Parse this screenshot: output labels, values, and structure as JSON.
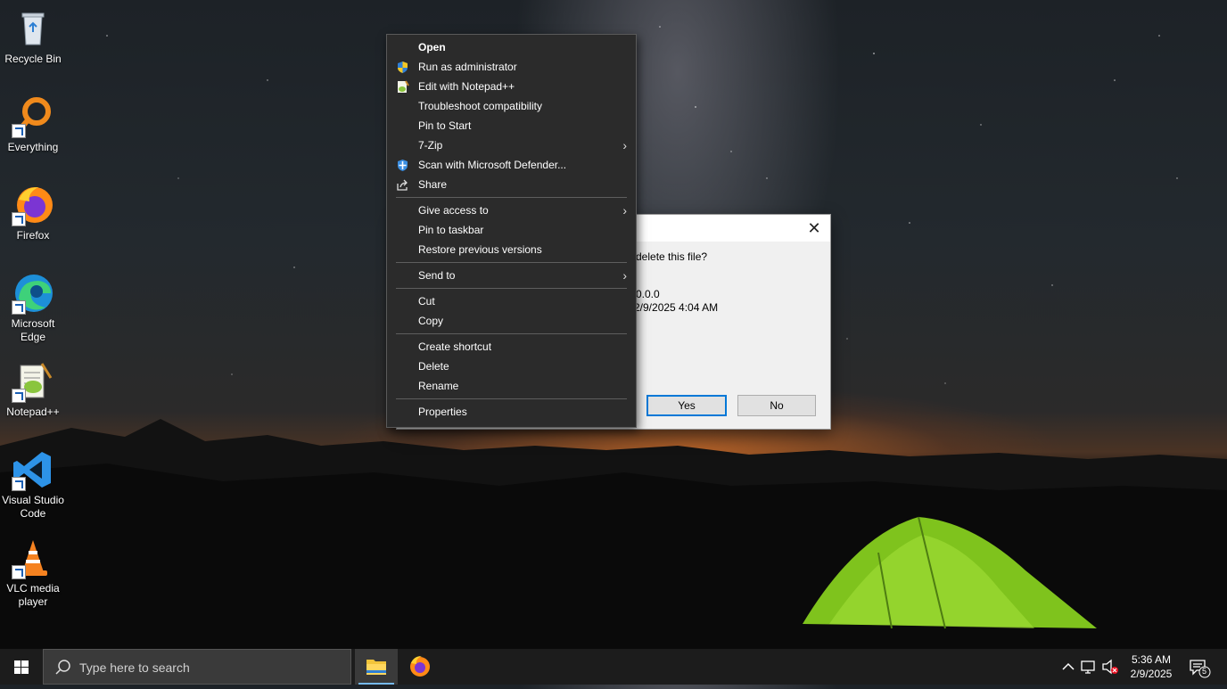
{
  "desktop": {
    "icons": [
      {
        "label": "Recycle Bin"
      },
      {
        "label": "Everything"
      },
      {
        "label": "Firefox"
      },
      {
        "label": "Microsoft Edge"
      },
      {
        "label": "Notepad++"
      },
      {
        "label": "Visual Studio Code"
      },
      {
        "label": "VLC media player"
      }
    ]
  },
  "dialog": {
    "close_glyph": "✕",
    "message": "delete this file?",
    "info_line1": "0.0.0",
    "info_line2": "2/9/2025 4:04 AM",
    "yes_label": "Yes",
    "no_label": "No"
  },
  "context_menu": {
    "items": [
      {
        "label": "Open"
      },
      {
        "label": "Run as administrator",
        "icon": "shield-icon"
      },
      {
        "label": "Edit with Notepad++",
        "icon": "notepadpp-icon"
      },
      {
        "label": "Troubleshoot compatibility"
      },
      {
        "label": "Pin to Start"
      },
      {
        "label": "7-Zip",
        "submenu": true
      },
      {
        "label": "Scan with Microsoft Defender...",
        "icon": "defender-icon"
      },
      {
        "label": "Share",
        "icon": "share-icon"
      },
      {
        "label": "Give access to",
        "submenu": true
      },
      {
        "label": "Pin to taskbar"
      },
      {
        "label": "Restore previous versions"
      },
      {
        "label": "Send to",
        "submenu": true
      },
      {
        "label": "Cut"
      },
      {
        "label": "Copy"
      },
      {
        "label": "Create shortcut"
      },
      {
        "label": "Delete"
      },
      {
        "label": "Rename"
      },
      {
        "label": "Properties"
      }
    ],
    "submenu_glyph": "›"
  },
  "taskbar": {
    "search_placeholder": "Type here to search",
    "clock_time": "5:36 AM",
    "clock_date": "2/9/2025",
    "notification_count": "5"
  },
  "colors": {
    "accent": "#0078d7",
    "menu_bg": "#2b2b2b",
    "taskbar_bg": "#1c1c1c"
  }
}
